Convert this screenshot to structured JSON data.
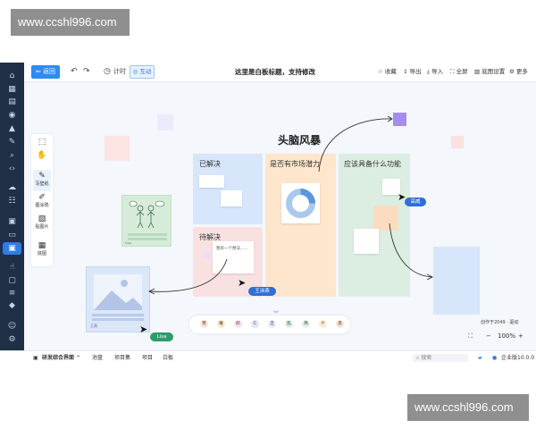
{
  "watermark": {
    "top": "www.ccshl996.com",
    "bottom": "www.ccshl996.com"
  },
  "toolbar": {
    "back_label": "返回",
    "timer_label": "计时",
    "interact_label": "互动",
    "board_title": "这里是白板标题，支持修改",
    "collect_label": "收藏",
    "export_label": "导出",
    "import_label": "导入",
    "fullscreen_label": "全屏",
    "bg_settings_label": "底图设置",
    "more_label": "更多"
  },
  "palette": {
    "items": [
      {
        "label": "写壁纸"
      },
      {
        "label": "图涂鸦"
      },
      {
        "label": "贴图片"
      },
      {
        "label": "底图"
      }
    ]
  },
  "board": {
    "main_title": "头脑风暴",
    "columns": [
      {
        "title": "已解决"
      },
      {
        "title": "是否有市场潜力"
      },
      {
        "title": "应该具备什么功能"
      },
      {
        "title": "待解决"
      }
    ],
    "note_text": "我有一个想法......",
    "card_caption": "Lisa",
    "image_caption": "王燕"
  },
  "tags": {
    "gao_wei": "高威",
    "wang_yan": "王涂燕",
    "lisa": "Lisa"
  },
  "stickers": [
    "赞",
    "难",
    "好",
    "C",
    "乏",
    "乱",
    "简",
    "P",
    "思"
  ],
  "version_text": "创作于2049 · 驱动",
  "zoom": {
    "value": "100%",
    "minus": "−",
    "plus": "+"
  },
  "bottombar": {
    "workspace": "研发综合界面",
    "tabs": [
      "池盘",
      "项目集",
      "项目",
      "白板"
    ],
    "search_placeholder": "搜索",
    "edition": "企业版10.0.0"
  },
  "colors": {
    "accent": "#2f8bf0",
    "sidebar": "#1f2f46",
    "col_blue": "#d7e6fb",
    "col_orange": "#fde6cc",
    "col_green": "#dceee2",
    "col_pink": "#f9e1e1",
    "tag_blue": "#2f6fd6",
    "tag_green": "#2e9b68"
  }
}
